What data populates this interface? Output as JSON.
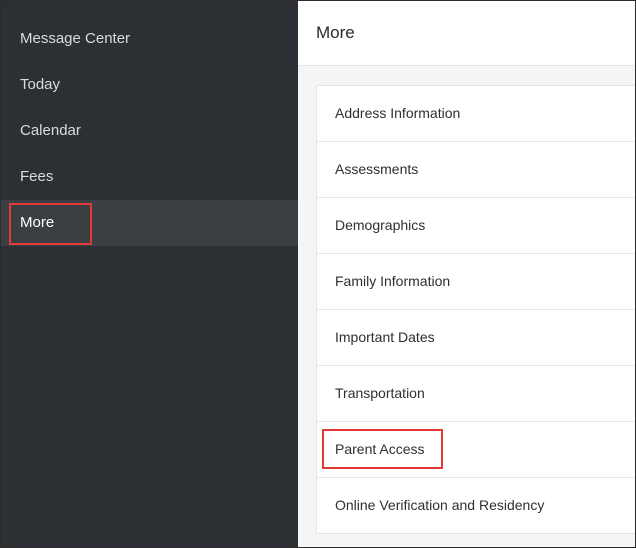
{
  "sidebar": {
    "items": [
      {
        "label": "Message Center",
        "active": false
      },
      {
        "label": "Today",
        "active": false
      },
      {
        "label": "Calendar",
        "active": false
      },
      {
        "label": "Fees",
        "active": false
      },
      {
        "label": "More",
        "active": true
      }
    ]
  },
  "main": {
    "title": "More",
    "list": [
      {
        "label": "Address Information"
      },
      {
        "label": "Assessments"
      },
      {
        "label": "Demographics"
      },
      {
        "label": "Family Information"
      },
      {
        "label": "Important Dates"
      },
      {
        "label": "Transportation"
      },
      {
        "label": "Parent Access",
        "highlighted": true
      },
      {
        "label": "Online Verification and Residency"
      }
    ]
  },
  "colors": {
    "sidebar_bg": "#2c3034",
    "sidebar_active_bg": "#3a3f44",
    "highlight_border": "#e53935",
    "main_bg": "#f4f5f6"
  }
}
